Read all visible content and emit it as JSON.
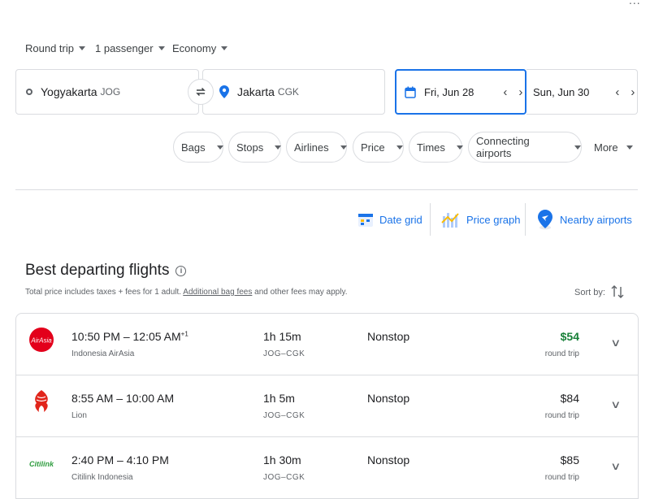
{
  "corner_menu": "...",
  "top_selectors": {
    "trip_type": "Round trip",
    "passengers": "1 passenger",
    "cabin": "Economy"
  },
  "search": {
    "origin_city": "Yogyakarta",
    "origin_code": "JOG",
    "destination_city": "Jakarta",
    "destination_code": "CGK",
    "depart_date": "Fri, Jun 28",
    "return_date": "Sun, Jun 30"
  },
  "filters": [
    "Bags",
    "Stops",
    "Airlines",
    "Price",
    "Times",
    "Connecting airports"
  ],
  "more_label": "More",
  "tools": {
    "date_grid": "Date grid",
    "price_graph": "Price graph",
    "nearby_airports": "Nearby airports"
  },
  "results": {
    "title": "Best departing flights",
    "subtitle_before": "Total price includes taxes + fees for 1 adult.",
    "subtitle_link": "Additional bag fees",
    "subtitle_after": "and other fees may apply.",
    "sort_label": "Sort by:",
    "flights": [
      {
        "depart": "10:50 PM",
        "arrive": "12:05 AM",
        "next_day": "+1",
        "airline": "Indonesia AirAsia",
        "logo_text": "AirAsia",
        "duration": "1h 15m",
        "route": "JOG–CGK",
        "stops": "Nonstop",
        "price": "$54",
        "trip_type": "round trip",
        "highlight_color": "#188038"
      },
      {
        "depart": "8:55 AM",
        "arrive": "10:00 AM",
        "next_day": "",
        "airline": "Lion",
        "logo_text": "",
        "duration": "1h 5m",
        "route": "JOG–CGK",
        "stops": "Nonstop",
        "price": "$84",
        "trip_type": "round trip",
        "highlight_color": ""
      },
      {
        "depart": "2:40 PM",
        "arrive": "4:10 PM",
        "next_day": "",
        "airline": "Citilink Indonesia",
        "logo_text": "Citilink",
        "duration": "1h 30m",
        "route": "JOG–CGK",
        "stops": "Nonstop",
        "price": "$85",
        "trip_type": "round trip",
        "highlight_color": ""
      }
    ]
  },
  "colors": {
    "accent": "#1a73e8",
    "price_best": "#188038",
    "airasia_red": "#e3001b",
    "lion_red": "#e1251b",
    "citilink_green": "#2e9c3e"
  }
}
